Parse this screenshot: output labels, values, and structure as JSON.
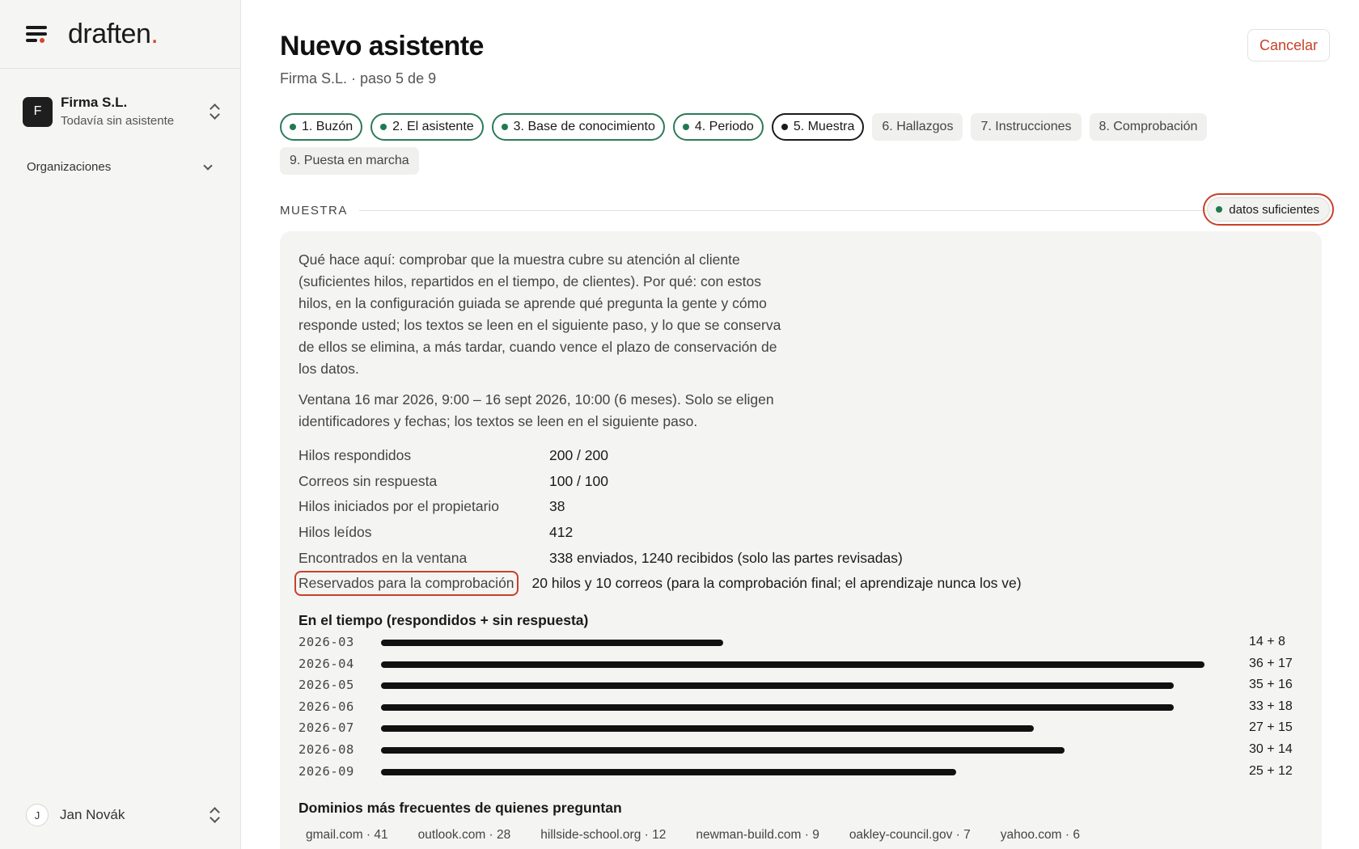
{
  "sidebar": {
    "logo": "draften",
    "logo_dot": ".",
    "org": {
      "initial": "F",
      "name": "Firma S.L.",
      "subtitle": "Todavía sin asistente"
    },
    "section_label": "Organizaciones",
    "user": {
      "initial": "J",
      "name": "Jan Novák"
    }
  },
  "header": {
    "title": "Nuevo asistente",
    "subtitle": "Firma S.L. · paso 5 de 9",
    "cancel_label": "Cancelar"
  },
  "steps": [
    {
      "label": "1. Buzón",
      "state": "done"
    },
    {
      "label": "2. El asistente",
      "state": "done"
    },
    {
      "label": "3. Base de conocimiento",
      "state": "done"
    },
    {
      "label": "4. Periodo",
      "state": "done"
    },
    {
      "label": "5. Muestra",
      "state": "current"
    },
    {
      "label": "6. Hallazgos",
      "state": "todo"
    },
    {
      "label": "7. Instrucciones",
      "state": "todo"
    },
    {
      "label": "8. Comprobación",
      "state": "todo"
    },
    {
      "label": "9. Puesta en marcha",
      "state": "todo"
    }
  ],
  "section": {
    "label": "MUESTRA",
    "badge": "datos suficientes"
  },
  "card": {
    "intro": "Qué hace aquí: comprobar que la muestra cubre su atención al cliente (suficientes hilos, repartidos en el tiempo, de clientes). Por qué: con estos hilos, en la configuración guiada se aprende qué pregunta la gente y cómo responde usted; los textos se leen en el siguiente paso, y lo que se conserva de ellos se elimina, a más tardar, cuando vence el plazo de conservación de los datos.",
    "window": "Ventana 16 mar 2026, 9:00 – 16 sept 2026, 10:00 (6 meses). Solo se eligen identificadores y fechas; los textos se leen en el siguiente paso.",
    "stats": [
      {
        "label": "Hilos respondidos",
        "value": "200 / 200"
      },
      {
        "label": "Correos sin respuesta",
        "value": "100 / 100"
      },
      {
        "label": "Hilos iniciados por el propietario",
        "value": "38"
      },
      {
        "label": "Hilos leídos",
        "value": "412"
      },
      {
        "label": "Encontrados en la ventana",
        "value": "338 enviados, 1240 recibidos (solo las partes revisadas)"
      },
      {
        "label": "Reservados para la comprobación",
        "value": "20 hilos y 10 correos (para la comprobación final; el aprendizaje nunca los ve)"
      }
    ],
    "timeline_title": "En el tiempo (respondidos + sin respuesta)",
    "timeline": [
      {
        "month": "2026-03",
        "answered": 14,
        "unanswered": 8,
        "label": "14 + 8"
      },
      {
        "month": "2026-04",
        "answered": 36,
        "unanswered": 17,
        "label": "36 + 17"
      },
      {
        "month": "2026-05",
        "answered": 35,
        "unanswered": 16,
        "label": "35 + 16"
      },
      {
        "month": "2026-06",
        "answered": 33,
        "unanswered": 18,
        "label": "33 + 18"
      },
      {
        "month": "2026-07",
        "answered": 27,
        "unanswered": 15,
        "label": "27 + 15"
      },
      {
        "month": "2026-08",
        "answered": 30,
        "unanswered": 14,
        "label": "30 + 14"
      },
      {
        "month": "2026-09",
        "answered": 25,
        "unanswered": 12,
        "label": "25 + 12"
      }
    ],
    "domains_title": "Dominios más frecuentes de quienes preguntan",
    "domains": [
      "gmail.com · 41",
      "outlook.com · 28",
      "hillside-school.org · 12",
      "newman-build.com · 9",
      "oakley-council.gov · 7",
      "yahoo.com · 6"
    ]
  },
  "colors": {
    "accent": "#c8412a",
    "done": "#1f7a4f",
    "bar": "#111111"
  }
}
